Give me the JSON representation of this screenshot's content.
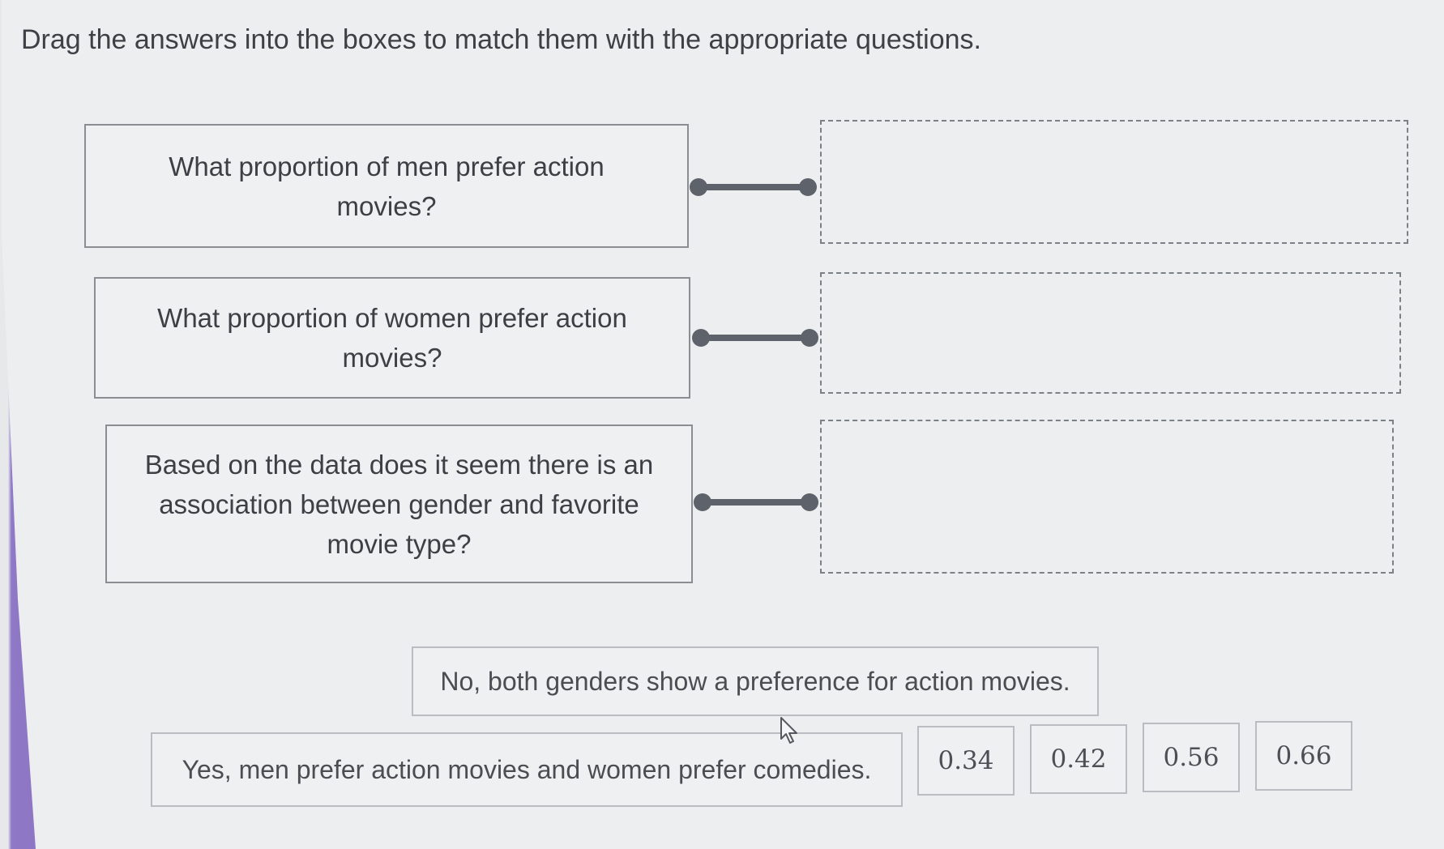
{
  "instructions": "Drag the answers into the boxes to match them with the appropriate questions.",
  "questions": [
    {
      "text": "What proportion of men prefer action movies?"
    },
    {
      "text": "What proportion of women prefer action movies?"
    },
    {
      "text": "Based on the data does it seem there is an association between gender and favorite movie type?"
    }
  ],
  "answers": [
    {
      "text": "No, both genders show a preference for action movies."
    },
    {
      "text": "Yes, men prefer action movies and women prefer comedies."
    },
    {
      "text": "0.34"
    },
    {
      "text": "0.42"
    },
    {
      "text": "0.56"
    },
    {
      "text": "0.66"
    }
  ],
  "colors": {
    "connector": "#5d626b",
    "accent_bar": "#8d76c4"
  },
  "icons": {
    "cursor": "mouse-pointer-icon"
  }
}
